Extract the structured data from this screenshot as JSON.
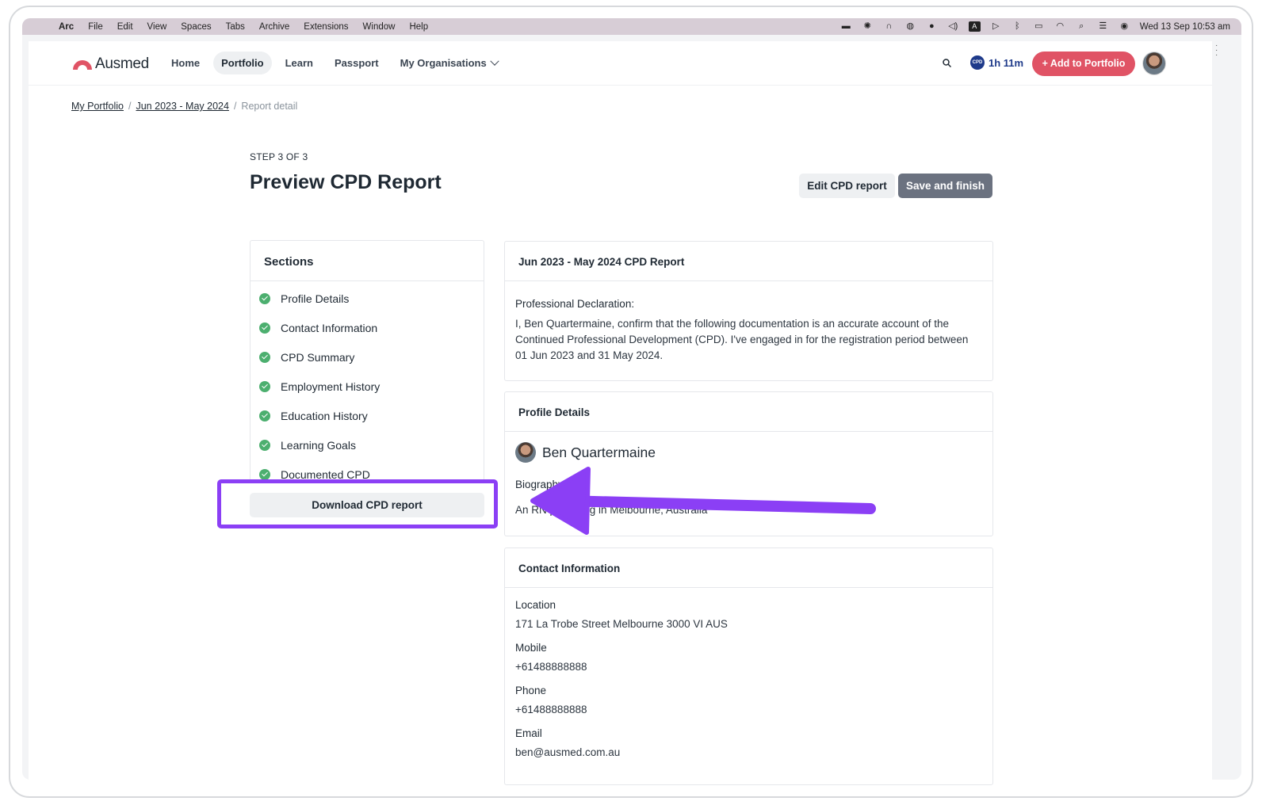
{
  "menubar": {
    "app": "Arc",
    "items": [
      "File",
      "Edit",
      "View",
      "Spaces",
      "Tabs",
      "Archive",
      "Extensions",
      "Window",
      "Help"
    ],
    "status_icons": [
      "keyboard-icon",
      "brightness-icon",
      "headphones-icon",
      "password-icon",
      "grammar-icon",
      "volume-icon",
      "input-source-icon",
      "play-icon",
      "bluetooth-icon",
      "battery-icon",
      "wifi-icon",
      "spotlight-icon",
      "control-center-icon",
      "siri-icon"
    ],
    "input_source": "A",
    "datetime": "Wed 13 Sep  10:53 am"
  },
  "nav": {
    "logo": "Ausmed",
    "links": [
      "Home",
      "Portfolio",
      "Learn",
      "Passport",
      "My Organisations"
    ],
    "active": "Portfolio",
    "cpd_badge": "CPD",
    "cpd_time": "1h 11m",
    "add_button": "+ Add to Portfolio"
  },
  "breadcrumb": {
    "items": [
      "My Portfolio",
      "Jun 2023 - May 2024"
    ],
    "current": "Report detail"
  },
  "header": {
    "step": "STEP 3 OF 3",
    "title": "Preview CPD Report",
    "edit_button": "Edit CPD report",
    "save_button": "Save and finish"
  },
  "sections": {
    "title": "Sections",
    "items": [
      "Profile Details",
      "Contact Information",
      "CPD Summary",
      "Employment History",
      "Education History",
      "Learning Goals",
      "Documented CPD"
    ],
    "download_button": "Download CPD report"
  },
  "report": {
    "title": "Jun 2023 - May 2024 CPD Report",
    "declaration_label": "Professional Declaration:",
    "declaration_text": "I, Ben Quartermaine, confirm that the following documentation is an accurate account of the Continued Professional Development (CPD). I've engaged in for the registration period between 01 Jun 2023 and 31 May 2024."
  },
  "profile": {
    "title": "Profile Details",
    "name": "Ben Quartermaine",
    "bio_label": "Biography",
    "bio_text": "An RN practising in Melbourne, Australia"
  },
  "contact": {
    "title": "Contact Information",
    "location_label": "Location",
    "location": "171 La Trobe Street Melbourne 3000 VI AUS",
    "mobile_label": "Mobile",
    "mobile": "+61488888888",
    "phone_label": "Phone",
    "phone": "+61488888888",
    "email_label": "Email",
    "email": "ben@ausmed.com.au"
  },
  "annotation_color": "#8b3ff5"
}
